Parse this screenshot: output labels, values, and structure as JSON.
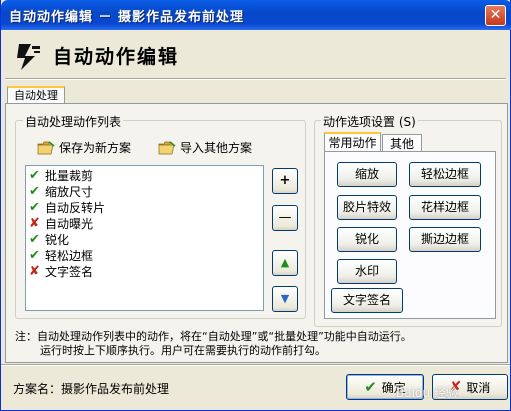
{
  "window": {
    "title": "自动动作编辑 － 摄影作品发布前处理",
    "close_glyph": "✕"
  },
  "header": {
    "title": "自动动作编辑"
  },
  "main_tab": "自动处理",
  "list_group": {
    "label": "自动处理动作列表",
    "save_label": "保存为新方案",
    "import_label": "导入其他方案",
    "items": [
      {
        "label": "批量裁剪",
        "status": "checked"
      },
      {
        "label": "缩放尺寸",
        "status": "checked"
      },
      {
        "label": "自动反转片",
        "status": "checked"
      },
      {
        "label": "自动曝光",
        "status": "unchecked"
      },
      {
        "label": "锐化",
        "status": "checked"
      },
      {
        "label": "轻松边框",
        "status": "checked"
      },
      {
        "label": "文字签名",
        "status": "unchecked"
      }
    ],
    "side_buttons": {
      "add": "+",
      "remove": "—",
      "up": "▲",
      "down": "▼"
    }
  },
  "options_group": {
    "label": "动作选项设置 (S)",
    "tabs": [
      "常用动作",
      "其他"
    ],
    "buttons": {
      "zoom": "缩放",
      "easy_border": "轻松边框",
      "film_effect": "胶片特效",
      "flower_border": "花样边框",
      "sharpen": "锐化",
      "tear_border": "撕边边框",
      "watermark": "水印",
      "text_sign": "文字签名"
    }
  },
  "note": {
    "line1": "注：自动处理动作列表中的动作，将在“自动处理”或“批量处理”功能中自动运行。",
    "line2": "运行时按上下顺序执行。用户可在需要执行的动作前打勾。"
  },
  "footer": {
    "scheme": "方案名：摄影作品发布前处理",
    "ok": "确定",
    "cancel": "取消"
  },
  "watermark": "Baidu 经验",
  "colors": {
    "titlebar": "#0a5de6",
    "dialog_bg": "#ece9d8",
    "check": "#1f8f1f",
    "cross": "#c0281c"
  }
}
